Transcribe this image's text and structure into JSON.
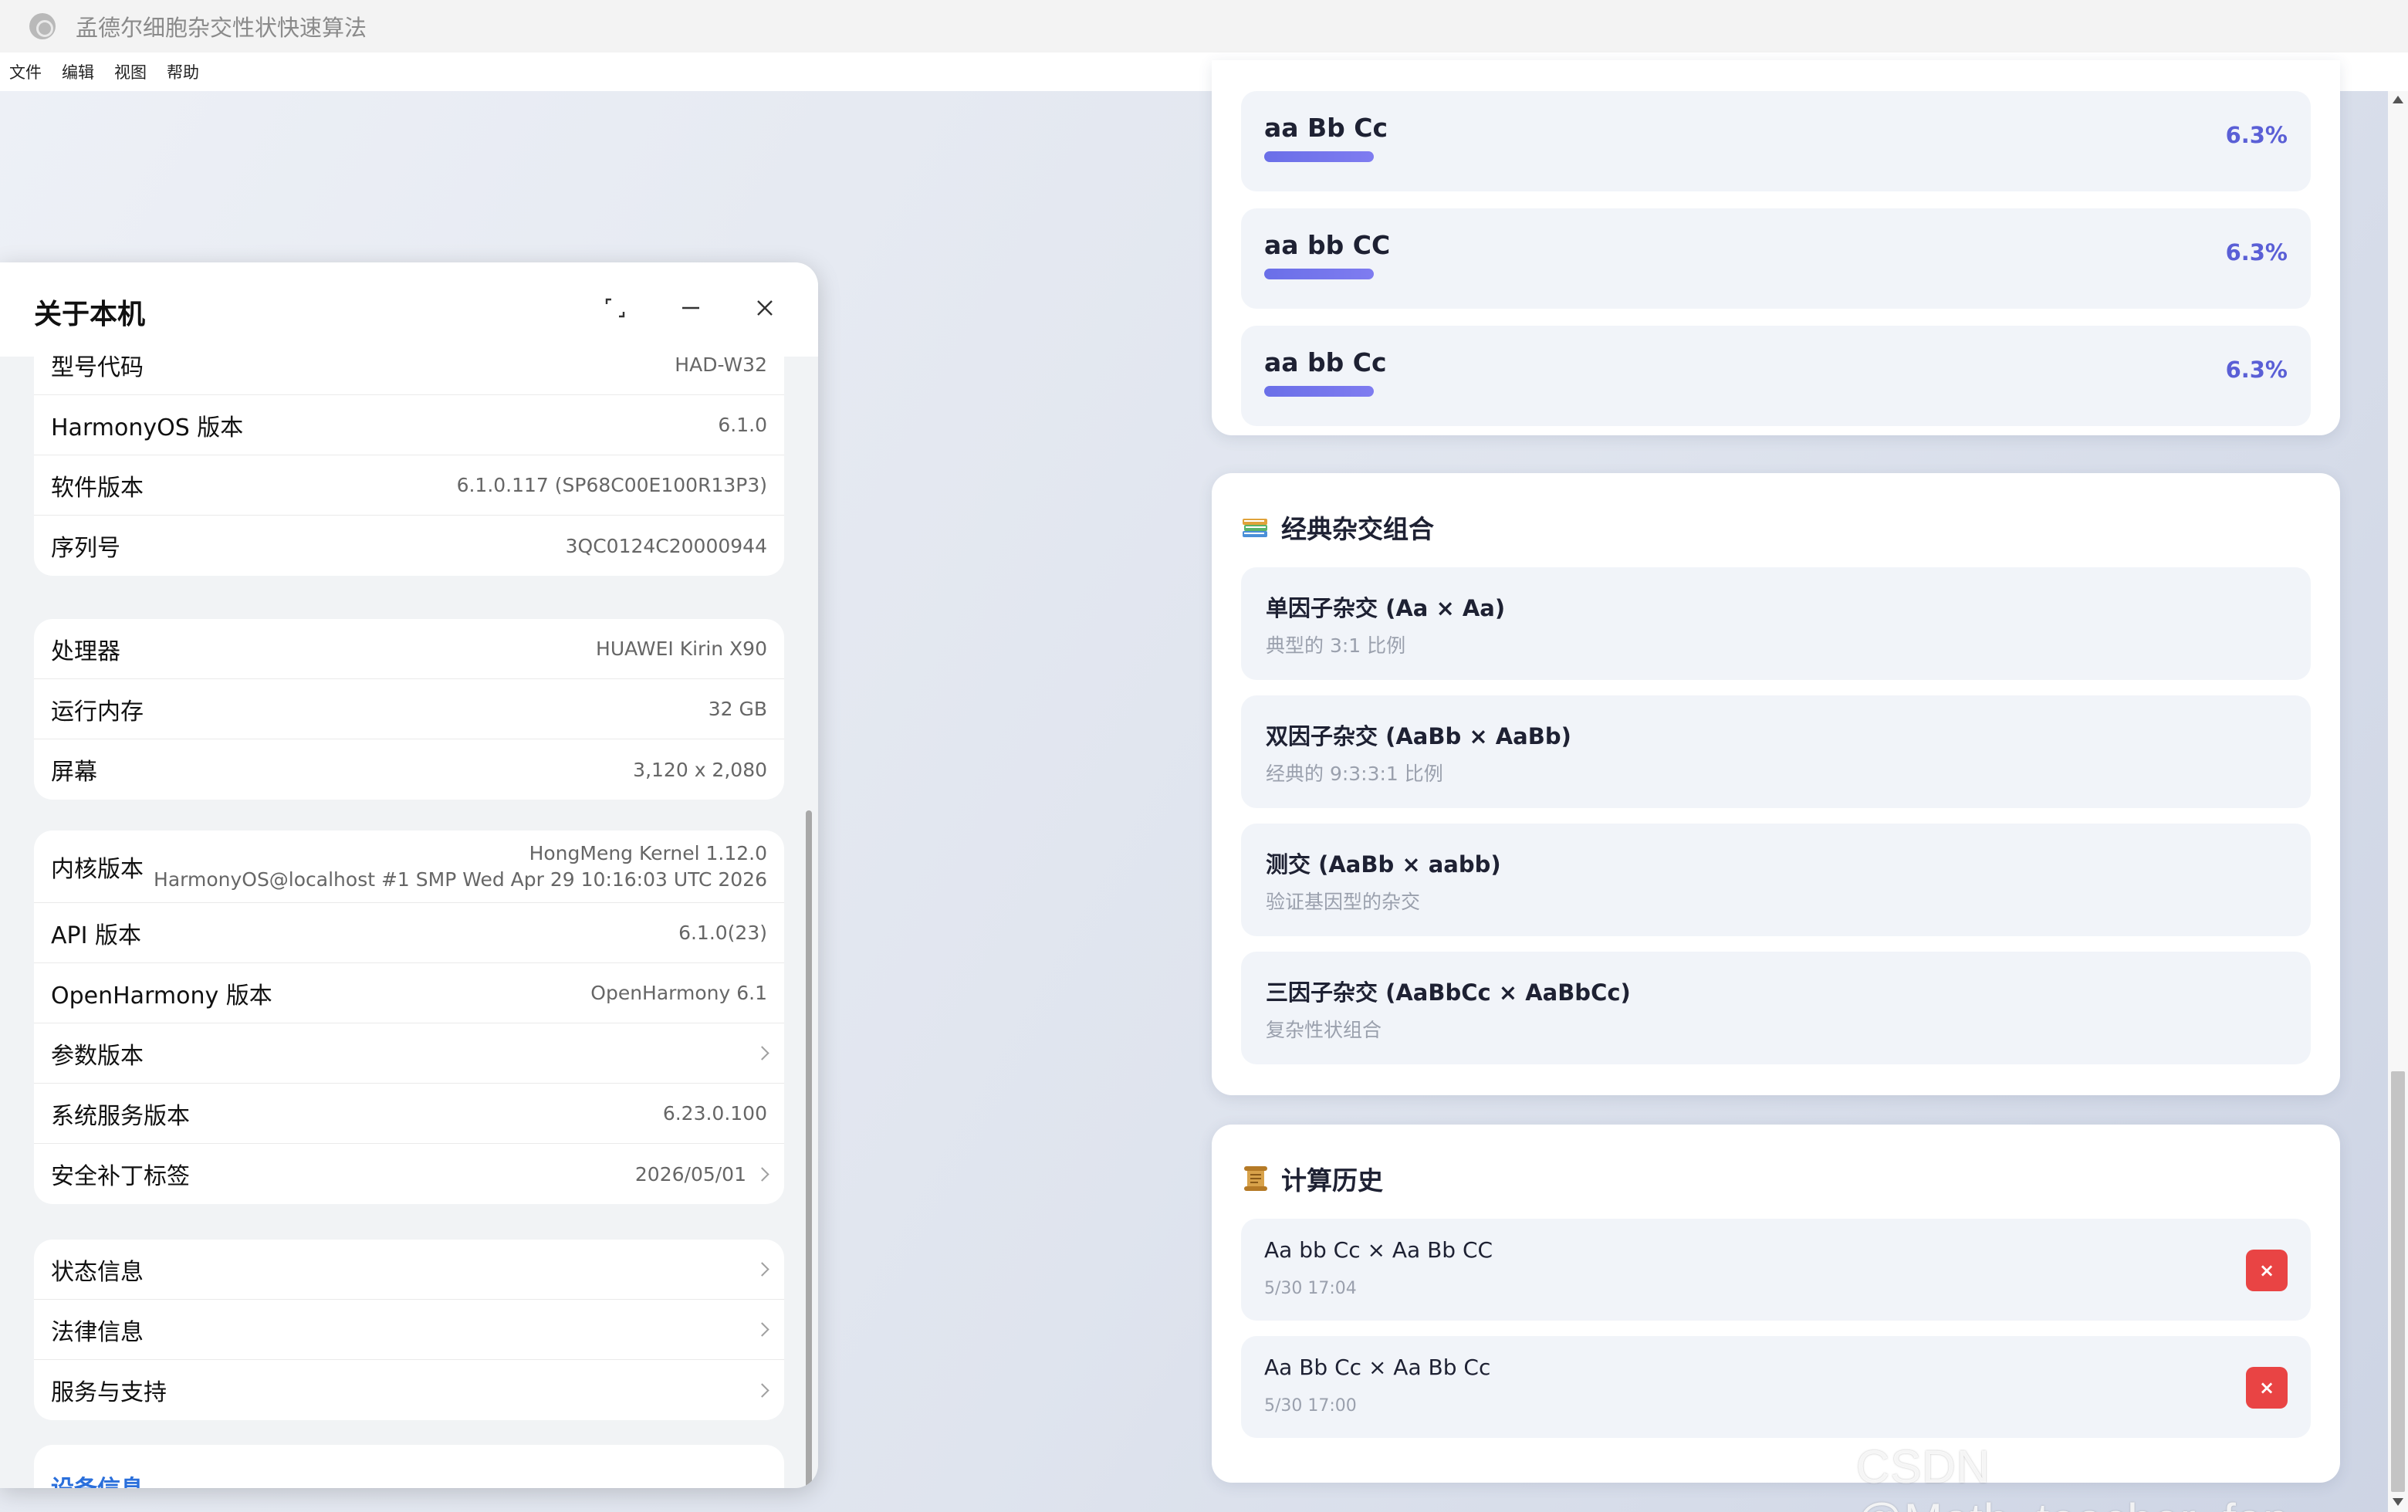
{
  "window": {
    "title": "孟德尔细胞杂交性状快速算法"
  },
  "menu": [
    "文件",
    "编辑",
    "视图",
    "帮助"
  ],
  "phenotypes": [
    {
      "name": "aa Bb Cc",
      "percent": "6.3%",
      "ratio": 0.063
    },
    {
      "name": "aa bb CC",
      "percent": "6.3%",
      "ratio": 0.063
    },
    {
      "name": "aa bb Cc",
      "percent": "6.3%",
      "ratio": 0.063
    }
  ],
  "classic": {
    "title": "经典杂交组合",
    "icon": "books-icon",
    "items": [
      {
        "name": "单因子杂交 (Aa × Aa)",
        "desc": "典型的 3:1 比例"
      },
      {
        "name": "双因子杂交 (AaBb × AaBb)",
        "desc": "经典的 9:3:3:1 比例"
      },
      {
        "name": "测交 (AaBb × aabb)",
        "desc": "验证基因型的杂交"
      },
      {
        "name": "三因子杂交 (AaBbCc × AaBbCc)",
        "desc": "复杂性状组合"
      }
    ]
  },
  "history": {
    "title": "计算历史",
    "icon": "scroll-icon",
    "delete_label": "×",
    "items": [
      {
        "cross": "Aa bb Cc × Aa Bb CC",
        "time": "5/30 17:04"
      },
      {
        "cross": "Aa Bb Cc × Aa Bb Cc",
        "time": "5/30 17:00"
      }
    ]
  },
  "about": {
    "title": "关于本机",
    "group1": [
      {
        "label": "型号代码",
        "value": "HAD-W32"
      },
      {
        "label": "HarmonyOS 版本",
        "value": "6.1.0"
      },
      {
        "label": "软件版本",
        "value": "6.1.0.117 (SP68C00E100R13P3)"
      },
      {
        "label": "序列号",
        "value": "3QC0124C20000944"
      }
    ],
    "group2": [
      {
        "label": "处理器",
        "value": "HUAWEI Kirin X90"
      },
      {
        "label": "运行内存",
        "value": "32 GB"
      },
      {
        "label": "屏幕",
        "value": "3,120 x 2,080"
      }
    ],
    "group3": {
      "kernel_label": "内核版本",
      "kernel_line1": "HongMeng Kernel 1.12.0",
      "kernel_line2": "HarmonyOS@localhost #1 SMP Wed Apr 29 10:16:03 UTC 2026",
      "rows": [
        {
          "label": "API 版本",
          "value": "6.1.0(23)"
        },
        {
          "label": "OpenHarmony 版本",
          "value": "OpenHarmony 6.1"
        },
        {
          "label": "参数版本",
          "value": ""
        },
        {
          "label": "系统服务版本",
          "value": "6.23.0.100"
        },
        {
          "label": "安全补丁标签",
          "value": "2026/05/01"
        }
      ]
    },
    "group4": [
      {
        "label": "状态信息"
      },
      {
        "label": "法律信息"
      },
      {
        "label": "服务与支持"
      }
    ],
    "device_info_link": "设备信息"
  },
  "watermark": "CSDN @Math_teacher_fan"
}
